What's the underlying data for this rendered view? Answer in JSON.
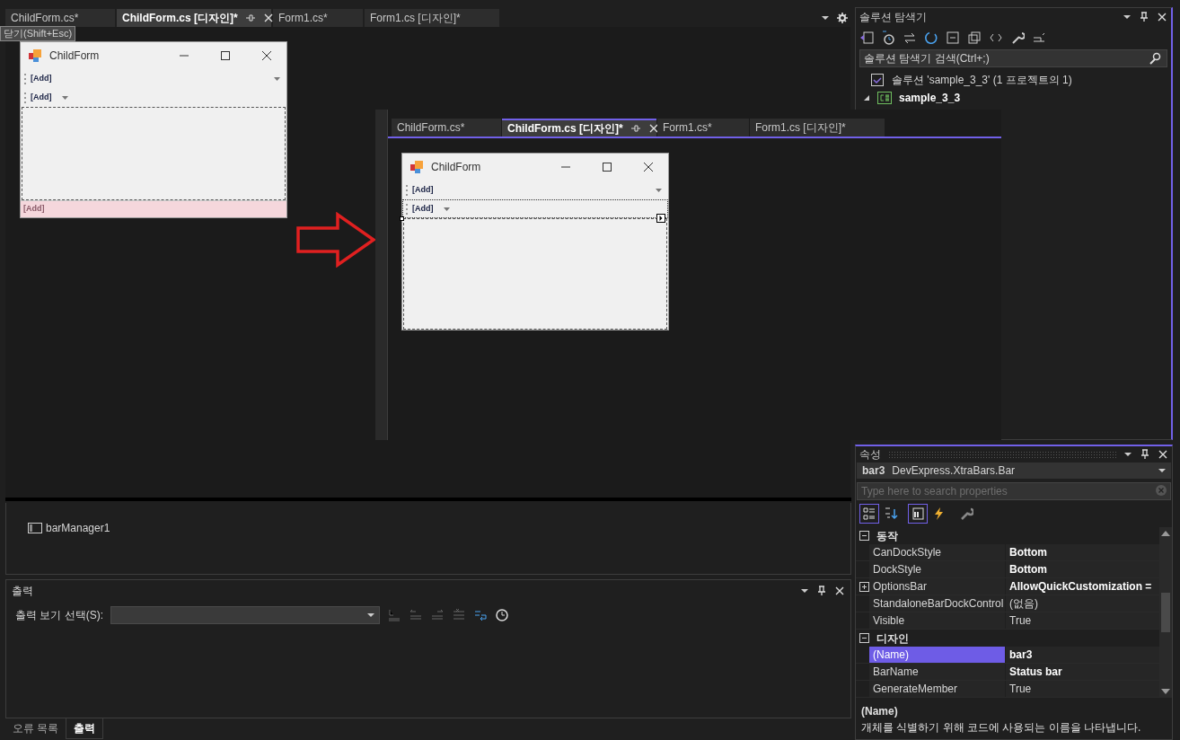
{
  "document_tabs": [
    {
      "label": "ChildForm.cs*",
      "selected": false
    },
    {
      "label": "ChildForm.cs [디자인]*",
      "selected": true
    },
    {
      "label": "Form1.cs*",
      "selected": false
    },
    {
      "label": "Form1.cs [디자인]*",
      "selected": false
    }
  ],
  "designer": {
    "form": {
      "title": "ChildForm",
      "bars": [
        {
          "kind": "main_menu",
          "label": "[Add]",
          "selected": false
        },
        {
          "kind": "toolbar",
          "label": "[Add]",
          "selected": false
        }
      ],
      "status_bar": {
        "label": "[Add]"
      }
    },
    "tooltip": {
      "text": "닫기(Shift+Esc)"
    }
  },
  "component_tray": [
    {
      "label": "barManager1"
    }
  ],
  "output": {
    "title": "출력",
    "label": "출력 보기 선택(S):",
    "tabs": [
      {
        "label": "오류 목록",
        "selected": false
      },
      {
        "label": "출력",
        "selected": true
      }
    ]
  },
  "overlay": {
    "tabs": [
      {
        "label": "ChildForm.cs*",
        "selected": false
      },
      {
        "label": "ChildForm.cs [디자인]*",
        "selected": true
      },
      {
        "label": "Form1.cs*",
        "selected": false
      },
      {
        "label": "Form1.cs [디자인]*",
        "selected": false
      }
    ],
    "form": {
      "title": "ChildForm",
      "bars": [
        {
          "kind": "main_menu",
          "label": "[Add]",
          "selected": false
        },
        {
          "kind": "toolbar",
          "label": "[Add]",
          "selected": true
        }
      ]
    }
  },
  "solution_explorer": {
    "title": "솔루션 탐색기",
    "search": {
      "placeholder": "솔루션 탐색기 검색(Ctrl+;)"
    },
    "tree": [
      {
        "label": "솔루션 'sample_3_3'  (1 프로젝트의 1)",
        "children": [
          {
            "label": "sample_3_3",
            "expanded": true
          }
        ]
      }
    ]
  },
  "properties": {
    "title": "속성",
    "object_name": "bar3",
    "object_type": "DevExpress.XtraBars.Bar",
    "search": {
      "placeholder": "Type here to search properties"
    },
    "view_buttons": [
      {
        "kind": "categorized",
        "selected": true
      },
      {
        "kind": "alphabetical",
        "selected": false
      },
      {
        "kind": "properties",
        "selected": true
      },
      {
        "kind": "events",
        "selected": false
      },
      {
        "kind": "property_pages",
        "selected": false
      }
    ],
    "categories": [
      {
        "label": "동작",
        "expanded": true,
        "rows": [
          {
            "name": "CanDockStyle",
            "value": "Bottom",
            "modified": true,
            "expandable": false,
            "selected": false
          },
          {
            "name": "DockStyle",
            "value": "Bottom",
            "modified": true,
            "expandable": false,
            "selected": false
          },
          {
            "name": "OptionsBar",
            "value": "AllowQuickCustomization =",
            "modified": true,
            "expandable": true,
            "selected": false
          },
          {
            "name": "StandaloneBarDockControl",
            "value": "(없음)",
            "modified": false,
            "expandable": false,
            "selected": false
          },
          {
            "name": "Visible",
            "value": "True",
            "modified": false,
            "expandable": false,
            "selected": false
          }
        ]
      },
      {
        "label": "디자인",
        "expanded": true,
        "rows": [
          {
            "name": "(Name)",
            "value": "bar3",
            "modified": true,
            "expandable": false,
            "selected": true
          },
          {
            "name": "BarName",
            "value": "Status bar",
            "modified": true,
            "expandable": false,
            "selected": false
          },
          {
            "name": "GenerateMember",
            "value": "True",
            "modified": false,
            "expandable": false,
            "selected": false
          }
        ]
      }
    ],
    "description": {
      "title": "(Name)",
      "text": "개체를 식별하기 위해 코드에 사용되는 이름을 나타냅니다."
    }
  }
}
